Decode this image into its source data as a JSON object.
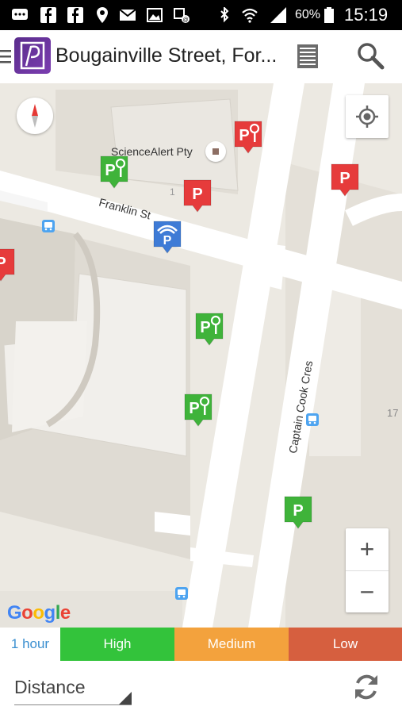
{
  "status_bar": {
    "battery_percent": "60%",
    "time": "15:19",
    "icons": [
      "message-icon",
      "facebook-icon",
      "facebook-icon",
      "location-icon",
      "mail-icon",
      "image-icon",
      "wifi-calling-icon",
      "bluetooth-icon",
      "wifi-icon",
      "signal-icon",
      "battery-icon"
    ]
  },
  "app_bar": {
    "title": "Bougainville Street, For...",
    "icons": [
      "menu-icon",
      "app-logo-icon",
      "list-icon",
      "search-icon"
    ]
  },
  "map": {
    "labels": {
      "poi": "ScienceAlert Pty",
      "street_franklin": "Franklin St",
      "street_captain_cook": "Captain Cook Cres",
      "number_1": "1",
      "number_17": "17"
    },
    "attribution": "Google",
    "attribution_colors": [
      "#4285F4",
      "#EA4335",
      "#FBBC05",
      "#4285F4",
      "#34A853",
      "#EA4335"
    ],
    "zoom_in_label": "+",
    "zoom_out_label": "−",
    "pin_colors": {
      "red": "#e63b3b",
      "green": "#3fb33a",
      "blue": "#3e7bd6"
    },
    "pins": [
      {
        "kind": "meter",
        "color": "red",
        "glyph": "P"
      },
      {
        "kind": "meter",
        "color": "green",
        "glyph": "P"
      },
      {
        "kind": "parking",
        "color": "red",
        "glyph": "P"
      },
      {
        "kind": "parking",
        "color": "red",
        "glyph": "P"
      },
      {
        "kind": "covered",
        "color": "blue",
        "glyph": "P"
      },
      {
        "kind": "parking",
        "color": "red",
        "glyph": "P"
      },
      {
        "kind": "meter",
        "color": "green",
        "glyph": "P"
      },
      {
        "kind": "meter",
        "color": "green",
        "glyph": "P"
      },
      {
        "kind": "parking",
        "color": "green",
        "glyph": "P"
      }
    ]
  },
  "legend": {
    "hour_label": "1 hour",
    "high_label": "High",
    "medium_label": "Medium",
    "low_label": "Low",
    "colors": {
      "high": "#33c33b",
      "medium": "#f3a23d",
      "low": "#d65f3f"
    }
  },
  "bottom": {
    "sort_value": "Distance"
  }
}
